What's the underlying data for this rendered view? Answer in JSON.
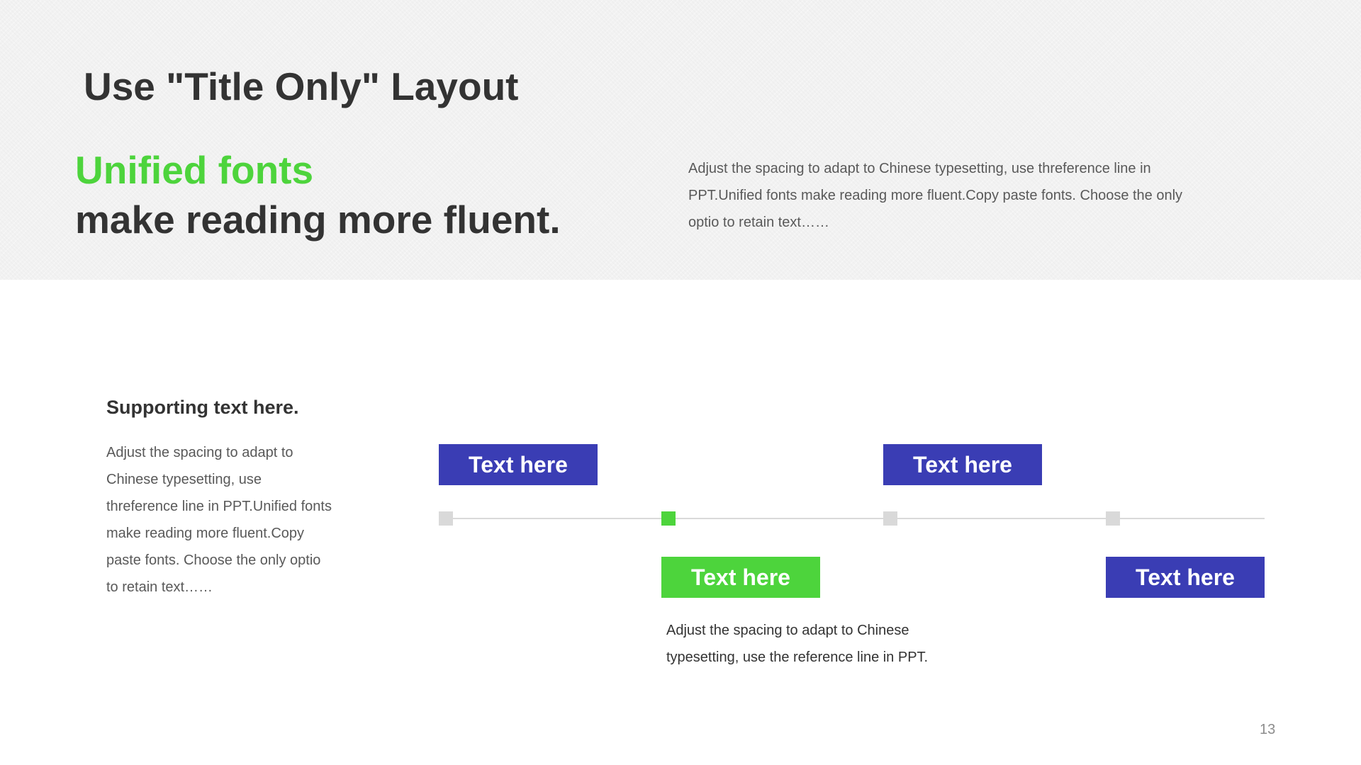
{
  "slide": {
    "title": "Use \"Title Only\" Layout",
    "page_number": "13"
  },
  "headline": {
    "accent_line": "Unified fonts",
    "rest_line": "make reading more fluent."
  },
  "top_paragraph": "Adjust the spacing to adapt to Chinese typesetting, use threference line in PPT.Unified fonts make reading more fluent.Copy paste fonts. Choose the only optio to retain text……",
  "support": {
    "heading": "Supporting text here.",
    "body": "Adjust the spacing to adapt to Chinese typesetting, use threference line in PPT.Unified fonts make reading more fluent.Copy paste fonts. Choose the only optio to retain text……"
  },
  "timeline": {
    "labels": [
      "Text here",
      "Text here",
      "Text here",
      "Text here"
    ],
    "description": "Adjust the spacing to adapt to Chinese typesetting, use the reference line in PPT."
  },
  "colors": {
    "accent_green": "#4dd43c",
    "box_blue": "#3a3db4",
    "node_gray": "#d9d9d9",
    "text_dark": "#333333",
    "band_gray": "#f2f2f2"
  }
}
